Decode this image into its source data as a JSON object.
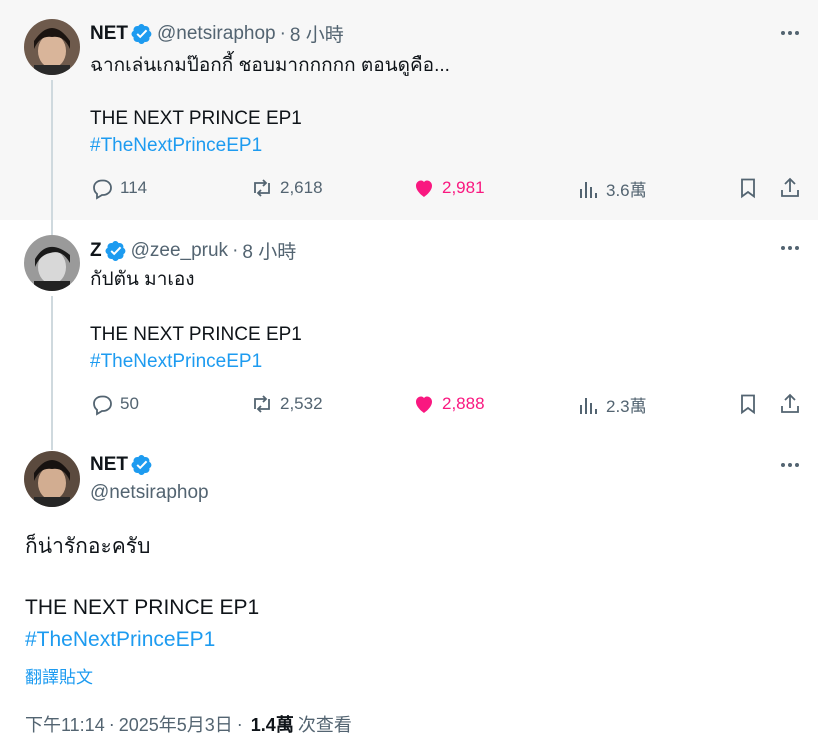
{
  "tweets": [
    {
      "name": "NET",
      "handle": "@netsiraphop",
      "separator": "·",
      "time": "8 小時",
      "text": "ฉากเล่นเกมป๊อกกี้ ชอบมากกกกก ตอนดูคือ...",
      "title": "THE NEXT PRINCE EP1",
      "hashtag": "#TheNextPrinceEP1",
      "stats": {
        "replies": "114",
        "reposts": "2,618",
        "likes": "2,981",
        "views": "3.6萬"
      }
    },
    {
      "name": "Z",
      "handle": "@zee_pruk",
      "separator": "·",
      "time": "8 小時",
      "text": "กัปตัน มาเอง",
      "title": "THE NEXT PRINCE EP1",
      "hashtag": "#TheNextPrinceEP1",
      "stats": {
        "replies": "50",
        "reposts": "2,532",
        "likes": "2,888",
        "views": "2.3萬"
      }
    }
  ],
  "main": {
    "name": "NET",
    "handle": "@netsiraphop",
    "text": "ก็น่ารักอะครับ",
    "title": "THE NEXT PRINCE EP1",
    "hashtag": "#TheNextPrinceEP1",
    "translate": "翻譯貼文",
    "time": "下午11:14",
    "sep1": "·",
    "date": "2025年5月3日",
    "sep2": "·",
    "views": "1.4萬",
    "views_label": "次查看"
  },
  "colors": {
    "accent": "#1d9bf0",
    "like": "#f91880",
    "muted": "#536471",
    "verified": "#1d9bf0"
  },
  "icons": [
    "verified-badge-icon",
    "more-icon",
    "reply-icon",
    "repost-icon",
    "like-icon",
    "views-icon",
    "bookmark-icon",
    "share-icon"
  ]
}
